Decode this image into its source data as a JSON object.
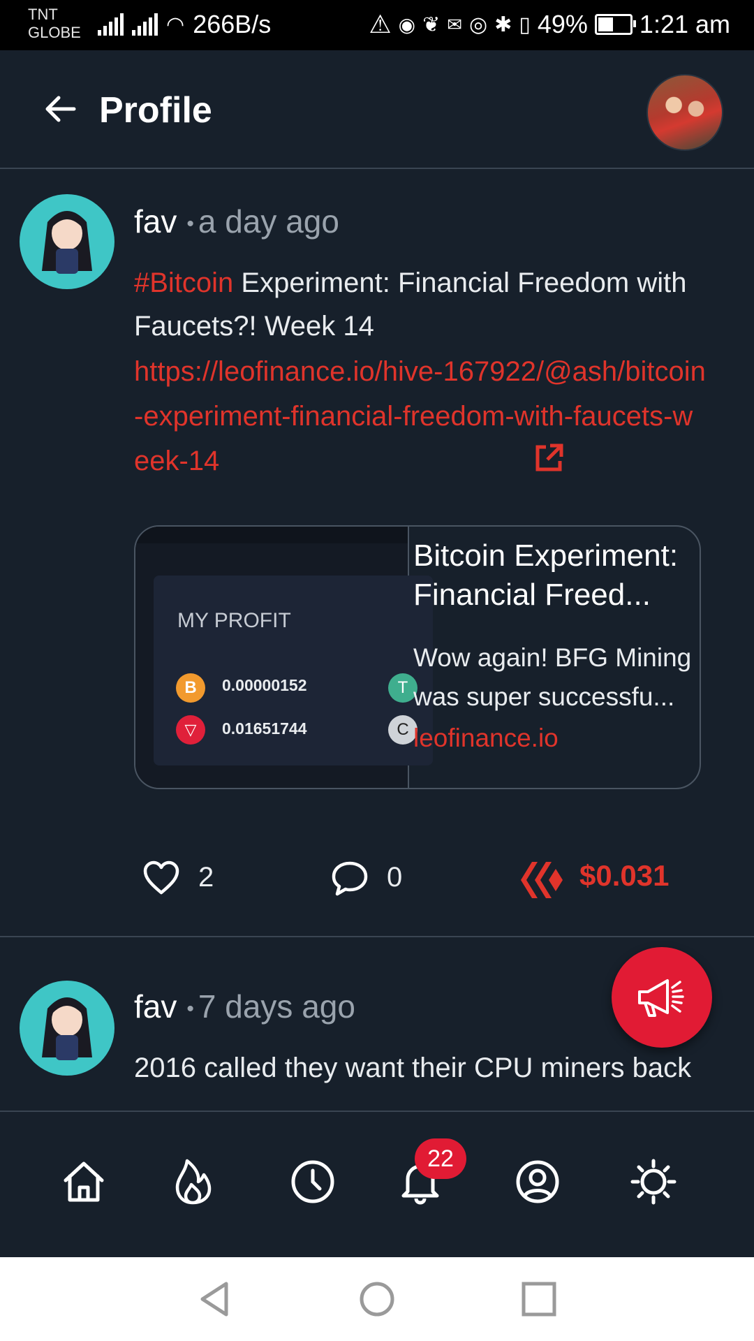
{
  "status_bar": {
    "carrier_line1": "TNT",
    "carrier_line2": "GLOBE",
    "net_speed": "266B/s",
    "battery": "49%",
    "time": "1:21 am"
  },
  "header": {
    "title": "Profile"
  },
  "posts": [
    {
      "username": "fav",
      "time": "a day ago",
      "hashtag": "#Bitcoin",
      "text": " Experiment: Financial Freedom with Faucets?! Week 14",
      "link": "https://leofinance.io/hive-167922/@ash/bitcoin-experiment-financial-freedom-with-faucets-week-14",
      "card": {
        "thumb_heading": "MY PROFIT",
        "thumb_value_1": "0.00000152",
        "thumb_value_2": "0.01651744",
        "title": "Bitcoin Experiment: Financial Freed...",
        "description": "Wow again! BFG Mining was super successfu...",
        "domain": "leofinance.io"
      },
      "likes": "2",
      "comments": "0",
      "payout": "$0.031"
    },
    {
      "username": "fav",
      "time": "7 days ago",
      "text": "2016 called they want their CPU miners back"
    }
  ],
  "bottom_nav": {
    "notification_count": "22"
  },
  "colors": {
    "accent": "#e0342b",
    "fab": "#e11b34",
    "background": "#17202b"
  }
}
